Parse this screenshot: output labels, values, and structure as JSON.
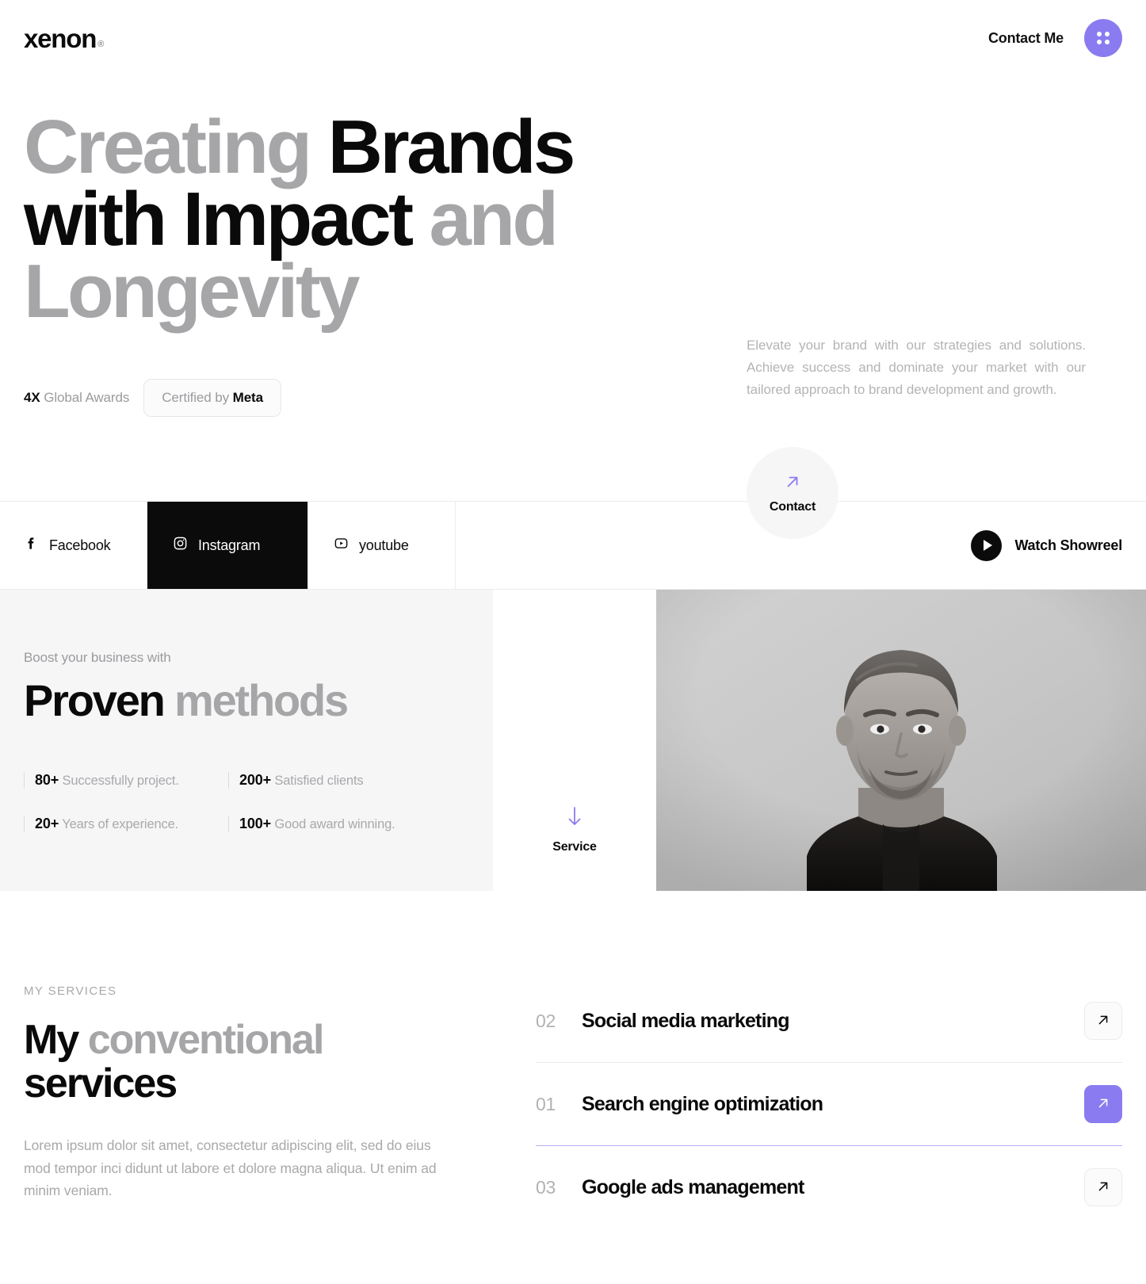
{
  "brand": {
    "name": "xenon",
    "registered": "®"
  },
  "header": {
    "contact_label": "Contact Me",
    "menu_icon": "grid-dots-icon"
  },
  "hero": {
    "title_line1_gray": "Creating",
    "title_line1_black": "Brands",
    "title_line2_black": "with Impact",
    "title_line2_gray": "and",
    "title_line3_gray": "Longevity",
    "awards_count": "4X",
    "awards_label": "Global Awards",
    "certified_prefix": "Certified by",
    "certified_brand": "Meta",
    "paragraph": "Elevate your brand with our strategies and solutions. Achieve  success and dominate your market with our tailored approach to brand development and growth.",
    "contact_button_label": "Contact",
    "contact_button_icon": "arrow-up-right-icon"
  },
  "social_bar": {
    "items": [
      {
        "label": "Facebook",
        "icon": "facebook-icon",
        "active": false
      },
      {
        "label": "Instagram",
        "icon": "instagram-icon",
        "active": true
      },
      {
        "label": "youtube",
        "icon": "youtube-icon",
        "active": false
      }
    ],
    "showreel_label": "Watch Showreel",
    "showreel_icon": "play-icon"
  },
  "methods": {
    "eyebrow": "Boost your business with",
    "title_black": "Proven",
    "title_gray": "methods",
    "stats": [
      {
        "value": "80+",
        "label": "Successfully project."
      },
      {
        "value": "200+",
        "label": "Satisfied clients"
      },
      {
        "value": "20+",
        "label": "Years of experience."
      },
      {
        "value": "100+",
        "label": "Good award winning."
      }
    ],
    "service_card_label": "Service",
    "service_card_icon": "arrow-down-icon",
    "photo_alt": "portrait-photo"
  },
  "services": {
    "eyebrow": "MY SERVICES",
    "title_black_1": "My",
    "title_gray": "conventional",
    "title_black_2": "services",
    "paragraph": "Lorem ipsum dolor sit amet, consectetur adipiscing elit, sed do eius mod tempor inci didunt ut labore et dolore magna aliqua. Ut enim ad minim veniam.",
    "items": [
      {
        "number": "02",
        "name": "Social media marketing",
        "icon": "arrow-up-right-icon",
        "active": false
      },
      {
        "number": "01",
        "name": "Search engine optimization",
        "icon": "arrow-up-right-icon",
        "active": true
      },
      {
        "number": "03",
        "name": "Google ads management",
        "icon": "arrow-up-right-icon",
        "active": false
      }
    ]
  },
  "colors": {
    "accent_purple": "#8b7bf0",
    "text_black": "#0a0a0b",
    "text_gray": "#a9a9ac",
    "panel_gray": "#f6f6f7"
  }
}
